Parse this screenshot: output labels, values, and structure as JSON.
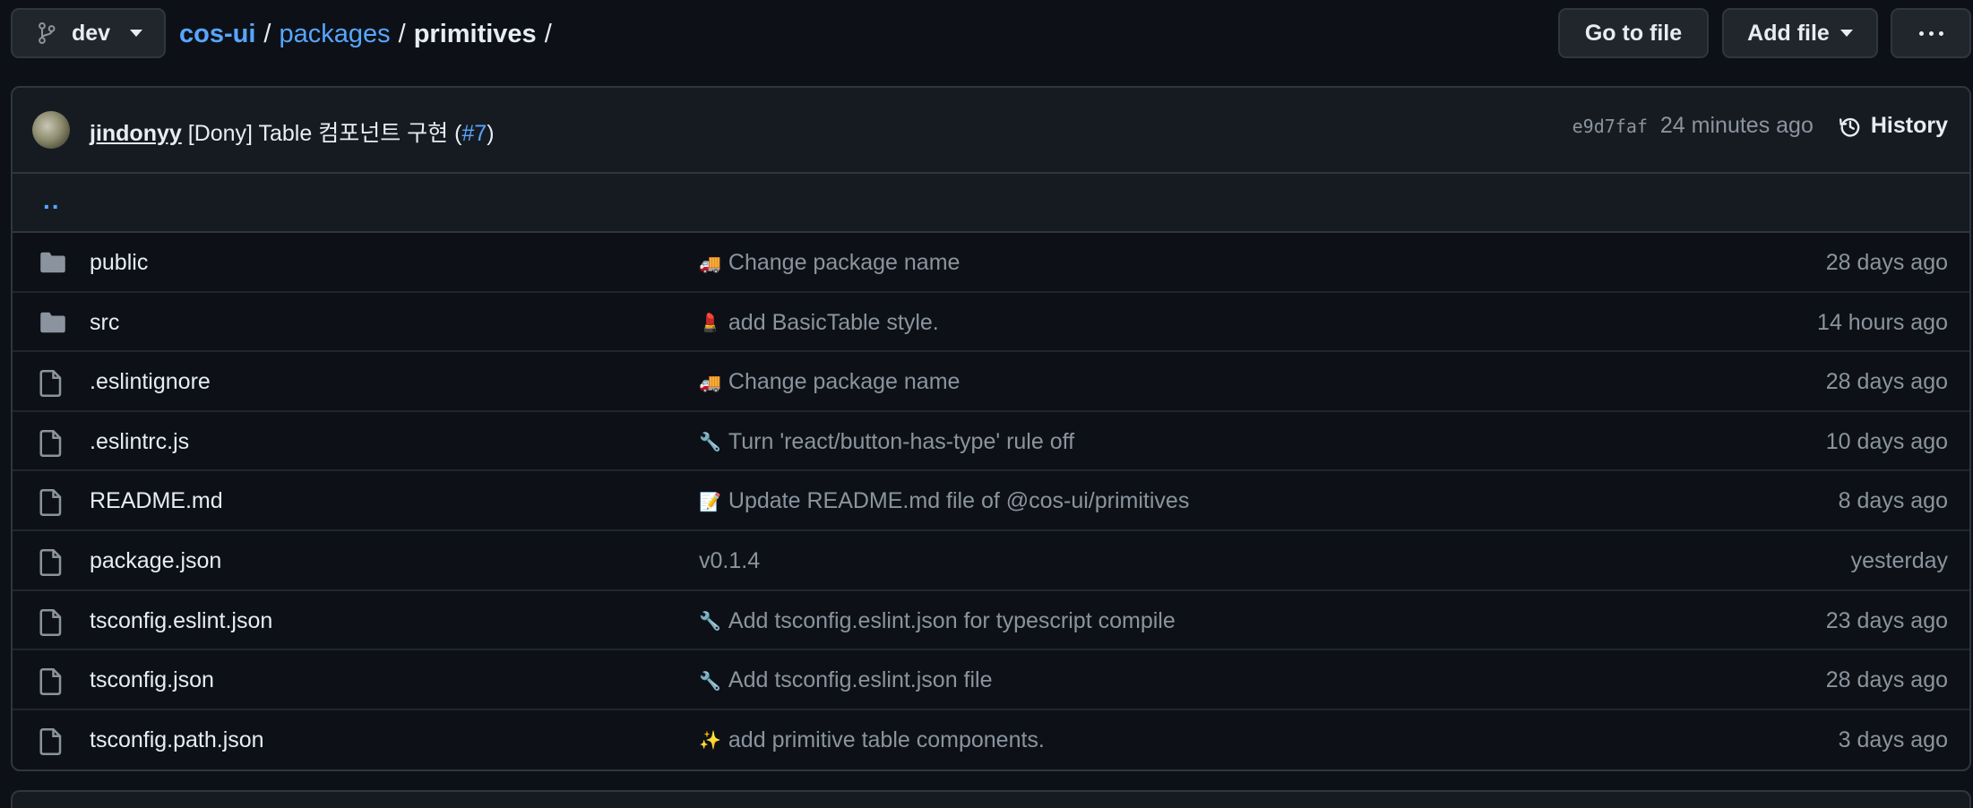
{
  "branch": {
    "name": "dev"
  },
  "breadcrumb": {
    "repo": "cos-ui",
    "packages": "packages",
    "current": "primitives",
    "sep": "/"
  },
  "toolbar": {
    "go_to_file": "Go to file",
    "add_file": "Add file"
  },
  "commit": {
    "author": "jindonyy",
    "message_prefix": "[Dony] Table 컴포넌트 구현 (",
    "pr": "#7",
    "message_suffix": ")",
    "sha": "e9d7faf",
    "time": "24 minutes ago",
    "history_label": "History"
  },
  "parent_dir": "..",
  "files": [
    {
      "name": "public",
      "type": "folder",
      "emoji": "🚚",
      "message": "Change package name",
      "age": "28 days ago"
    },
    {
      "name": "src",
      "type": "folder",
      "emoji": "💄",
      "message": "add BasicTable style.",
      "age": "14 hours ago"
    },
    {
      "name": ".eslintignore",
      "type": "file",
      "emoji": "🚚",
      "message": "Change package name",
      "age": "28 days ago"
    },
    {
      "name": ".eslintrc.js",
      "type": "file",
      "emoji": "🔧",
      "message": "Turn 'react/button-has-type' rule off",
      "age": "10 days ago"
    },
    {
      "name": "README.md",
      "type": "file",
      "emoji": "📝",
      "message": "Update README.md file of @cos-ui/primitives",
      "age": "8 days ago"
    },
    {
      "name": "package.json",
      "type": "file",
      "emoji": "",
      "message": "v0.1.4",
      "age": "yesterday"
    },
    {
      "name": "tsconfig.eslint.json",
      "type": "file",
      "emoji": "🔧",
      "message": "Add tsconfig.eslint.json for typescript compile",
      "age": "23 days ago"
    },
    {
      "name": "tsconfig.json",
      "type": "file",
      "emoji": "🔧",
      "message": "Add tsconfig.eslint.json file",
      "age": "28 days ago"
    },
    {
      "name": "tsconfig.path.json",
      "type": "file",
      "emoji": "✨",
      "message": "add primitive table components.",
      "age": "3 days ago"
    }
  ]
}
